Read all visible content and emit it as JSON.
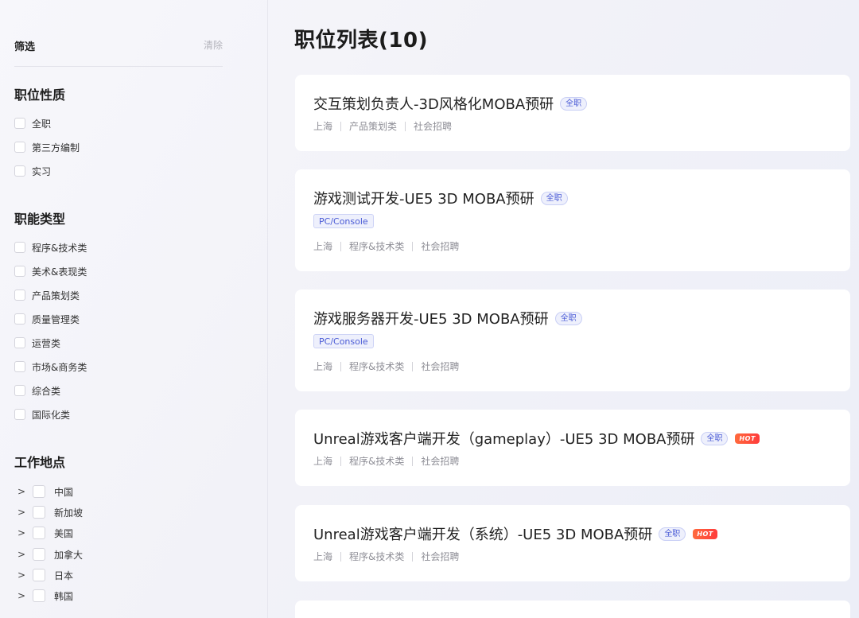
{
  "filter": {
    "title": "筛选",
    "clear": "清除",
    "sections": {
      "job_nature": {
        "title": "职位性质",
        "options": [
          "全职",
          "第三方编制",
          "实习"
        ]
      },
      "function_type": {
        "title": "职能类型",
        "options": [
          "程序&技术类",
          "美术&表现类",
          "产品策划类",
          "质量管理类",
          "运营类",
          "市场&商务类",
          "综合类",
          "国际化类"
        ]
      },
      "work_location": {
        "title": "工作地点",
        "options": [
          "中国",
          "新加坡",
          "美国",
          "加拿大",
          "日本",
          "韩国"
        ]
      }
    }
  },
  "main": {
    "title": "职位列表(10)",
    "jobs": [
      {
        "title": "交互策划负责人-3D风格化MOBA预研",
        "type_badge": "全职",
        "hot": false,
        "platform_tag": "",
        "city": "上海",
        "category": "产品策划类",
        "recruit": "社会招聘"
      },
      {
        "title": "游戏测试开发-UE5 3D MOBA预研",
        "type_badge": "全职",
        "hot": false,
        "platform_tag": "PC/Console",
        "city": "上海",
        "category": "程序&技术类",
        "recruit": "社会招聘"
      },
      {
        "title": "游戏服务器开发-UE5 3D MOBA预研",
        "type_badge": "全职",
        "hot": false,
        "platform_tag": "PC/Console",
        "city": "上海",
        "category": "程序&技术类",
        "recruit": "社会招聘"
      },
      {
        "title": "Unreal游戏客户端开发（gameplay）-UE5 3D MOBA预研",
        "type_badge": "全职",
        "hot": true,
        "hot_label": "HOT",
        "platform_tag": "",
        "city": "上海",
        "category": "程序&技术类",
        "recruit": "社会招聘"
      },
      {
        "title": "Unreal游戏客户端开发（系统）-UE5 3D MOBA预研",
        "type_badge": "全职",
        "hot": true,
        "hot_label": "HOT",
        "platform_tag": "",
        "city": "上海",
        "category": "程序&技术类",
        "recruit": "社会招聘"
      }
    ]
  },
  "colors": {
    "accent": "#4a5bd6",
    "hot": "#ff4d3a"
  }
}
